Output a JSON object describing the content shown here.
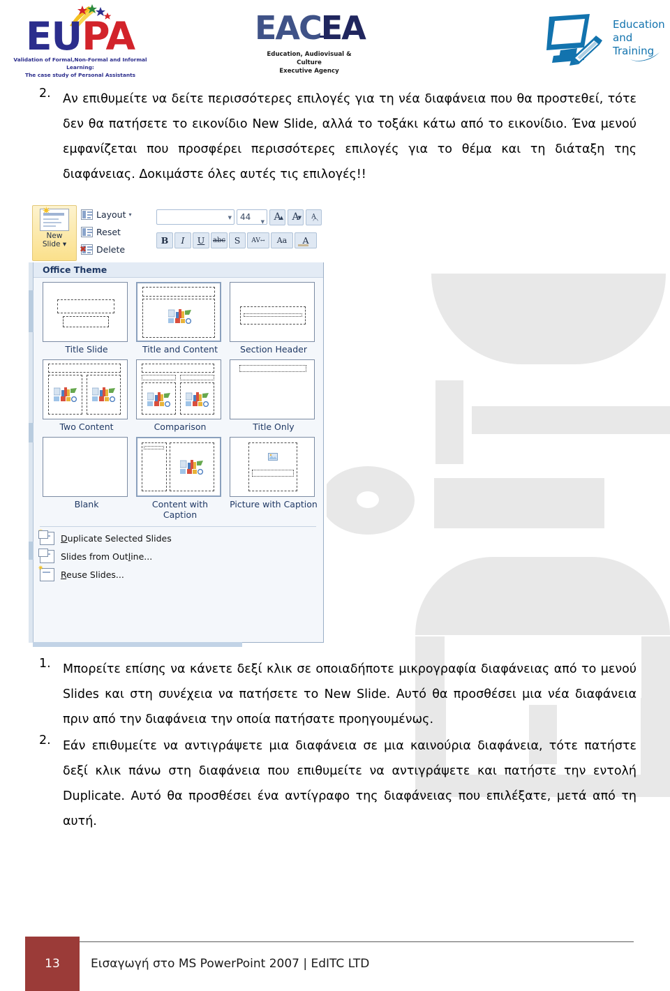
{
  "header": {
    "logos": [
      {
        "name": "eupa-logo",
        "word_first": "EU",
        "word_second": "PA",
        "subtitle_line1": "Validation of Formal,Non-Formal and Informal Learning:",
        "subtitle_line2": "The case study of Personal Assistants",
        "color_blue": "#2b2d8c",
        "color_red": "#d2232a"
      },
      {
        "name": "eacea-logo",
        "word_first": "EAC",
        "word_second": "EA",
        "subtitle_line1": "Education, Audiovisual & Culture",
        "subtitle_line2": "Executive Agency",
        "color": "#3f5287"
      },
      {
        "name": "education-and-training-logo",
        "line1": "Education",
        "line2": "and",
        "line3": "Training",
        "color": "#1273ae"
      }
    ]
  },
  "top_paragraph": {
    "number": "2.",
    "text": "Αν επιθυμείτε να δείτε περισσότερες επιλογές για τη νέα διαφάνεια που θα προστεθεί, τότε δεν θα πατήσετε το εικονίδιο New Slide, αλλά το τοξάκι κάτω από το εικονίδιο. Ένα μενού εμφανίζεται που προσφέρει περισσότερες επιλογές για το θέμα και τη διάταξη της διαφάνειας. Δοκιμάστε όλες αυτές τις επιλογές!!"
  },
  "screenshot": {
    "name": "powerpoint-new-slide-gallery-screenshot",
    "ribbon": {
      "new_slide_label_line1": "New",
      "new_slide_label_line2": "Slide",
      "new_slide_caret": "▾",
      "buttons": [
        {
          "label": "Layout",
          "caret": "▾",
          "icon": "layout-icon"
        },
        {
          "label": "Reset",
          "caret": "",
          "icon": "reset-icon"
        },
        {
          "label": "Delete",
          "caret": "",
          "icon": "delete-icon"
        }
      ],
      "font_name_value": "",
      "font_size_value": "44",
      "grow_font": "A",
      "shrink_font": "A",
      "clear_formatting": "Aa",
      "format_buttons": [
        "B",
        "I",
        "U",
        "abc",
        "S",
        "AV",
        "Aa",
        "A"
      ]
    },
    "gallery": {
      "header": "Office Theme",
      "layouts": [
        {
          "label": "Title Slide",
          "icon": "layout-title-slide"
        },
        {
          "label": "Title and Content",
          "icon": "layout-title-and-content"
        },
        {
          "label": "Section Header",
          "icon": "layout-section-header"
        },
        {
          "label": "Two Content",
          "icon": "layout-two-content"
        },
        {
          "label": "Comparison",
          "icon": "layout-comparison"
        },
        {
          "label": "Title Only",
          "icon": "layout-title-only"
        },
        {
          "label": "Blank",
          "icon": "layout-blank"
        },
        {
          "label": "Content with Caption",
          "icon": "layout-content-with-caption"
        },
        {
          "label": "Picture with Caption",
          "icon": "layout-picture-with-caption"
        }
      ],
      "menu_items": [
        {
          "label": "Duplicate Selected Slides",
          "accel": "D",
          "icon": "duplicate-slides-icon"
        },
        {
          "label": "Slides from Outline...",
          "accel": "l",
          "icon": "slides-from-outline-icon"
        },
        {
          "label": "Reuse Slides...",
          "accel": "R",
          "icon": "reuse-slides-icon"
        }
      ]
    }
  },
  "bottom_list": [
    {
      "number": "1.",
      "text": "Μπορείτε επίσης να κάνετε δεξί κλικ σε οποιαδήποτε μικρογραφία διαφάνειας από το μενού Slides και στη συνέχεια να πατήσετε το New Slide. Αυτό θα προσθέσει μια νέα διαφάνεια πριν από την διαφάνεια την οποία πατήσατε προηγουμένως."
    },
    {
      "number": "2.",
      "text": "Εάν επιθυμείτε να αντιγράψετε μια διαφάνεια σε μια καινούρια διαφάνεια, τότε πατήστε δεξί κλικ πάνω στη διαφάνεια που επιθυμείτε να αντιγράψετε και πατήστε την εντολή Duplicate. Αυτό θα προσθέσει ένα αντίγραφο της διαφάνειας που επιλέξατε, μετά από τη αυτή."
    }
  ],
  "footer": {
    "page_number": "13",
    "text": "Εισαγωγή στο MS PowerPoint 2007 | EdITC LTD",
    "box_color": "#9b3b38"
  }
}
